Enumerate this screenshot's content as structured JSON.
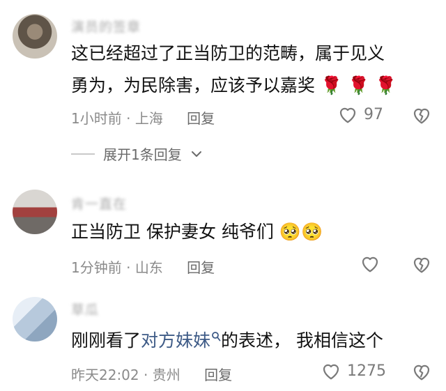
{
  "comments": [
    {
      "author": "演员的签章",
      "text_line1": "这已经超过了正当防卫的范畴，属于见义",
      "text_line2": "勇为，为民除害，应该予以嘉奖",
      "emoji": [
        "🌹",
        "🌹",
        "🌹"
      ],
      "time": "1小时前",
      "location": "上海",
      "reply_label": "回复",
      "likes": "97"
    },
    {
      "author": "肯一直在",
      "text_main": "正当防卫  保护妻女  纯爷们",
      "emoji": [
        "🥺",
        "🥺"
      ],
      "time": "1分钟前",
      "location": "山东",
      "reply_label": "回复",
      "likes": ""
    },
    {
      "author": "草瓜",
      "text_pre": "刚刚看了",
      "text_link": "对方妹妹",
      "text_post": "的表述，  我相信这个",
      "time": "昨天22:02",
      "location": "贵州",
      "reply_label": "回复",
      "likes": "1275"
    }
  ],
  "expand_replies_label": "展开1条回复",
  "separator": " · ",
  "icons": {
    "like": "heart-outline-icon",
    "dislike": "broken-heart-icon",
    "expand": "chevron-down-icon",
    "search": "search-icon"
  },
  "colors": {
    "text": "#111111",
    "meta": "#8a8a8a",
    "link": "#3d5a86"
  }
}
